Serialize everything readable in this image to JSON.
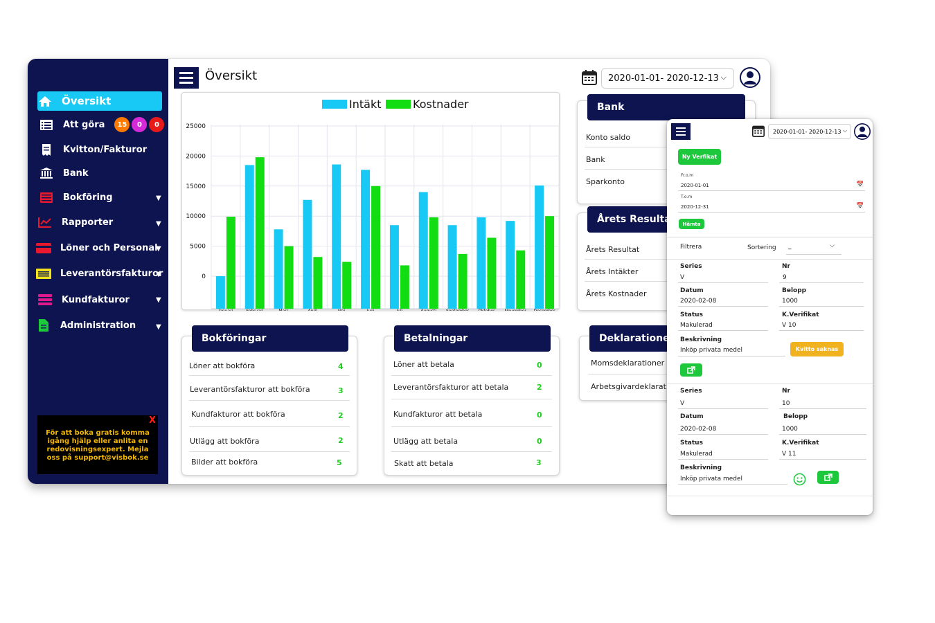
{
  "sidebar": {
    "items": [
      {
        "label": "Översikt",
        "icon": "home-icon"
      },
      {
        "label": "Att göra",
        "icon": "list-icon",
        "badges": [
          "15",
          "0",
          "0"
        ]
      },
      {
        "label": "Kvitton/Fakturor",
        "icon": "receipt-icon"
      },
      {
        "label": "Bank",
        "icon": "bank-icon"
      },
      {
        "label": "Bokföring",
        "icon": "ledger-icon"
      },
      {
        "label": "Rapporter",
        "icon": "chart-icon"
      },
      {
        "label": "Löner och Personal",
        "icon": "card-icon"
      },
      {
        "label": "Leverantörsfakturor",
        "icon": "invoice-icon"
      },
      {
        "label": "Kundfakturor",
        "icon": "stack-icon"
      },
      {
        "label": "Administration",
        "icon": "document-icon"
      }
    ],
    "promo": "För att boka gratis komma igång hjälp eller anlita en redovisningsexpert. Mejla oss på support@visbok.se",
    "promo_close": "X",
    "colors": {
      "background": "#0e1450",
      "active": "#19c9f5"
    }
  },
  "header": {
    "title": "Översikt",
    "date_range": "2020-01-01-  2020-12-13"
  },
  "chart_data": {
    "type": "bar",
    "categories": [
      "Januari",
      "Februari",
      "Mars",
      "April",
      "Maj",
      "Juni",
      "Juli",
      "Augusti",
      "September",
      "Oktober",
      "November",
      "December"
    ],
    "series": [
      {
        "name": "Intäkt",
        "color": "#19c9f5",
        "values": [
          -2000,
          18500,
          7800,
          12700,
          18600,
          17700,
          8500,
          14000,
          8500,
          9800,
          9200,
          15100
        ]
      },
      {
        "name": "Kostnader",
        "color": "#12dc12",
        "values": [
          9900,
          19800,
          5000,
          3200,
          2400,
          15000,
          1800,
          9800,
          3700,
          6400,
          4300,
          10000
        ]
      }
    ],
    "yticks": [
      "25000",
      "20000",
      "15000",
      "10000",
      "5000",
      "0"
    ],
    "ylim": [
      -5000,
      25000
    ],
    "grid": true,
    "legend": "top-center"
  },
  "bank": {
    "title": "Bank",
    "rows": [
      "Konto saldo",
      "Bank",
      "Sparkonto"
    ]
  },
  "result": {
    "title": "Årets Resultat",
    "rows": [
      "Årets Resultat",
      "Årets Intäkter",
      "Årets Kostnader"
    ]
  },
  "bokforingar": {
    "title": "Bokföringar",
    "rows": [
      {
        "label": "Löner att bokföra",
        "value": "4"
      },
      {
        "label": "Leverantörsfakturor att bokföra",
        "value": "3"
      },
      {
        "label": "Kundfakturor att bokföra",
        "value": "2"
      },
      {
        "label": "Utlägg att bokföra",
        "value": "2"
      },
      {
        "label": "Bilder att bokföra",
        "value": "5"
      }
    ]
  },
  "betalningar": {
    "title": "Betalningar",
    "rows": [
      {
        "label": "Löner att betala",
        "value": "0"
      },
      {
        "label": "Leverantörsfakturor att betala",
        "value": "2"
      },
      {
        "label": "Kundfakturor att betala",
        "value": "0"
      },
      {
        "label": "Utlägg att betala",
        "value": "0"
      },
      {
        "label": "Skatt att betala",
        "value": "3"
      }
    ]
  },
  "deklarationer": {
    "title": "Deklarationer",
    "rows": [
      "Momsdeklarationer",
      "Arbetsgivardeklarationer"
    ]
  },
  "mobile": {
    "date_range": "2020-01-01-  2020-12-13",
    "new_button": "Ny Verfikat",
    "from_label": "Fr.o.m",
    "from_value": "2020-01-01",
    "to_label": "T.o.m",
    "to_value": "2020-12-31",
    "fetch_button": "Hämta",
    "filter_label": "Filtrera",
    "sort_label": "Sortering",
    "sort_value": "_",
    "labels": {
      "series": "Series",
      "nr": "Nr",
      "datum": "Datum",
      "belopp": "Belopp",
      "status": "Status",
      "kverifikat": "K.Verifikat",
      "beskrivning": "Beskrivning"
    },
    "entries": [
      {
        "series": "V",
        "nr": "9",
        "datum": "2020-02-08",
        "belopp": "1000",
        "status": "Makulerad",
        "kverifikat": "V 10",
        "beskrivning": "Inköp privata medel",
        "receipt_button": "Kvitto saknas"
      },
      {
        "series": "V",
        "nr": "10",
        "datum": "2020-02-08",
        "belopp": "1000",
        "status": "Makulerad",
        "kverifikat": "V 11",
        "beskrivning": "Inköp privata medel"
      }
    ]
  }
}
